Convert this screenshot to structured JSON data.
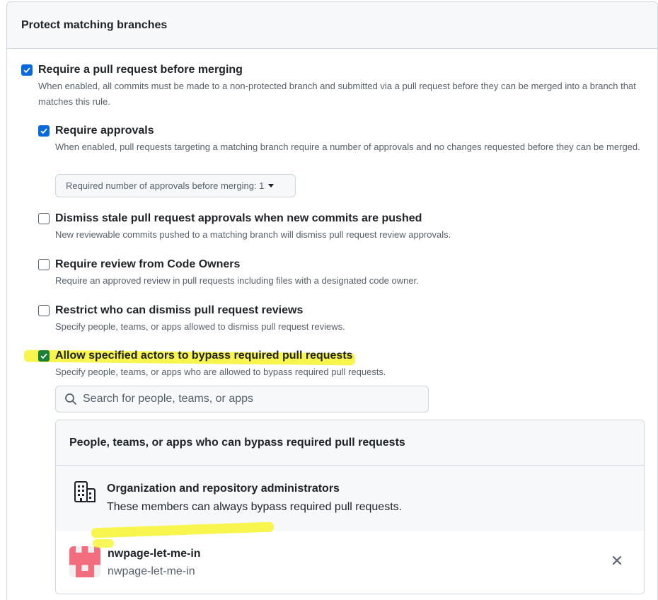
{
  "section": {
    "title": "Protect matching branches"
  },
  "options": {
    "require_pr": {
      "checked": true,
      "title": "Require a pull request before merging",
      "desc": "When enabled, all commits must be made to a non-protected branch and submitted via a pull request before they can be merged into a branch that matches this rule."
    },
    "require_approvals": {
      "checked": true,
      "title": "Require approvals",
      "desc": "When enabled, pull requests targeting a matching branch require a number of approvals and no changes requested before they can be merged.",
      "select_label": "Required number of approvals before merging: 1"
    },
    "dismiss_stale": {
      "checked": false,
      "title": "Dismiss stale pull request approvals when new commits are pushed",
      "desc": "New reviewable commits pushed to a matching branch will dismiss pull request review approvals."
    },
    "code_owners": {
      "checked": false,
      "title": "Require review from Code Owners",
      "desc": "Require an approved review in pull requests including files with a designated code owner."
    },
    "restrict_dismiss": {
      "checked": false,
      "title": "Restrict who can dismiss pull request reviews",
      "desc": "Specify people, teams, or apps allowed to dismiss pull request reviews."
    },
    "allow_bypass": {
      "checked": true,
      "title": "Allow specified actors to bypass required pull requests",
      "desc": "Specify people, teams, or apps who are allowed to bypass required pull requests."
    }
  },
  "search": {
    "placeholder": "Search for people, teams, or apps"
  },
  "bypass": {
    "header": "People, teams, or apps who can bypass required pull requests",
    "admin": {
      "icon": "organization-icon",
      "title": "Organization and repository administrators",
      "desc": "These members can always bypass required pull requests."
    },
    "users": [
      {
        "name": "nwpage-let-me-in",
        "login": "nwpage-let-me-in",
        "avatar_color": "#f26d7d"
      }
    ]
  },
  "colors": {
    "accent": "#0969da",
    "highlight": "#f7f43b"
  }
}
